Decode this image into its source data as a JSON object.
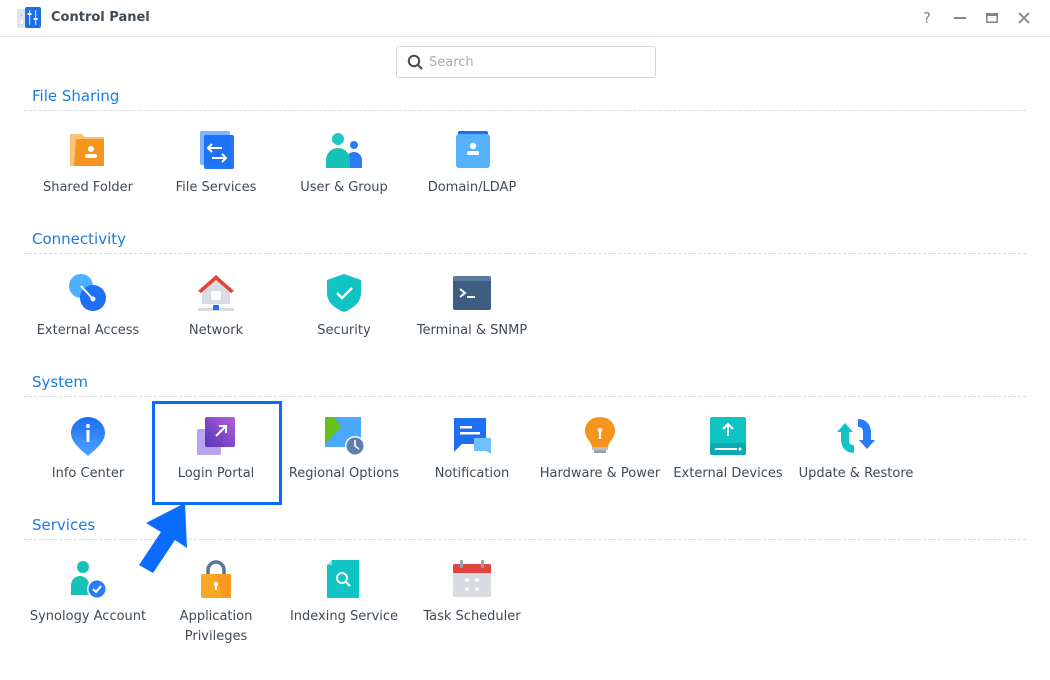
{
  "window": {
    "title": "Control Panel",
    "buttons": {
      "help": "?",
      "minimize": "minimize",
      "maximize": "maximize",
      "close": "close"
    }
  },
  "search": {
    "placeholder": "Search",
    "value": ""
  },
  "sections": [
    {
      "title": "File Sharing",
      "items": [
        {
          "label": "Shared Folder",
          "icon": "shared-folder-icon"
        },
        {
          "label": "File Services",
          "icon": "file-services-icon"
        },
        {
          "label": "User & Group",
          "icon": "user-group-icon"
        },
        {
          "label": "Domain/LDAP",
          "icon": "domain-ldap-icon"
        }
      ]
    },
    {
      "title": "Connectivity",
      "items": [
        {
          "label": "External Access",
          "icon": "external-access-icon"
        },
        {
          "label": "Network",
          "icon": "network-icon"
        },
        {
          "label": "Security",
          "icon": "security-shield-icon"
        },
        {
          "label": "Terminal & SNMP",
          "icon": "terminal-icon"
        }
      ]
    },
    {
      "title": "System",
      "items": [
        {
          "label": "Info Center",
          "icon": "info-center-icon"
        },
        {
          "label": "Login Portal",
          "icon": "login-portal-icon"
        },
        {
          "label": "Regional Options",
          "icon": "regional-options-icon"
        },
        {
          "label": "Notification",
          "icon": "notification-icon"
        },
        {
          "label": "Hardware & Power",
          "icon": "hardware-power-icon"
        },
        {
          "label": "External Devices",
          "icon": "external-devices-icon"
        },
        {
          "label": "Update & Restore",
          "icon": "update-restore-icon"
        }
      ]
    },
    {
      "title": "Services",
      "items": [
        {
          "label": "Synology Account",
          "icon": "synology-account-icon"
        },
        {
          "label": "Application Privileges",
          "icon": "application-privileges-icon"
        },
        {
          "label": "Indexing Service",
          "icon": "indexing-service-icon"
        },
        {
          "label": "Task Scheduler",
          "icon": "task-scheduler-icon"
        }
      ]
    }
  ],
  "annotation": {
    "highlighted_item": "Login Portal",
    "highlight_color": "#0a6cff"
  },
  "colors": {
    "accent": "#1e7be2",
    "text": "#414b55"
  }
}
